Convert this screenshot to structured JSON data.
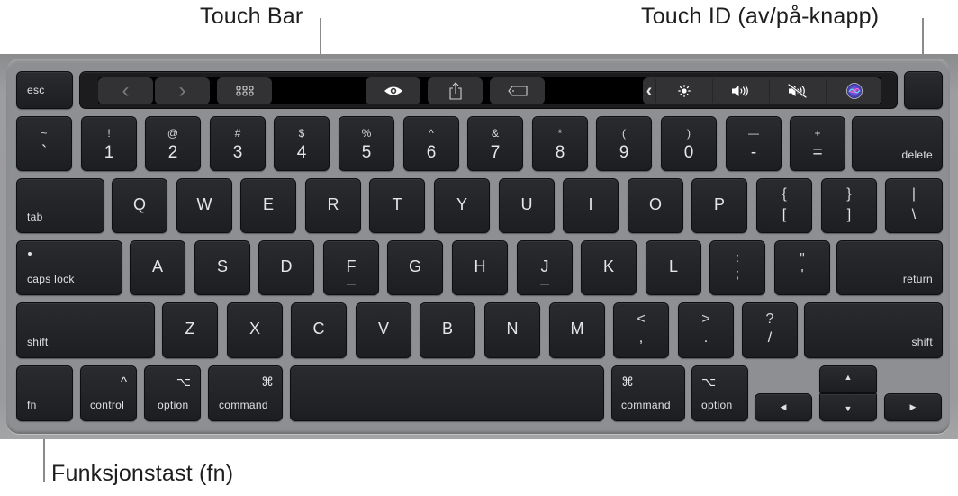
{
  "callouts": {
    "touch_bar": "Touch Bar",
    "touch_id": "Touch ID (av/på-knapp)",
    "fn_key": "Funksjonstast (fn)"
  },
  "touch_bar": {
    "back_icon": "‹",
    "forward_icon": "›",
    "grid_icon": "grid-view",
    "eye_icon": "quick-look",
    "share_icon": "share",
    "tag_icon": "tag",
    "collapse_icon": "‹",
    "brightness_icon": "brightness",
    "volume_icon": "volume",
    "mute_icon": "mute",
    "siri_icon": "siri"
  },
  "keys": {
    "esc": "esc",
    "row1": [
      {
        "top": "~",
        "bot": "`"
      },
      {
        "top": "!",
        "bot": "1"
      },
      {
        "top": "@",
        "bot": "2"
      },
      {
        "top": "#",
        "bot": "3"
      },
      {
        "top": "$",
        "bot": "4"
      },
      {
        "top": "%",
        "bot": "5"
      },
      {
        "top": "^",
        "bot": "6"
      },
      {
        "top": "&",
        "bot": "7"
      },
      {
        "top": "*",
        "bot": "8"
      },
      {
        "top": "(",
        "bot": "9"
      },
      {
        "top": ")",
        "bot": "0"
      },
      {
        "top": "—",
        "bot": "-"
      },
      {
        "top": "+",
        "bot": "="
      }
    ],
    "delete": "delete",
    "tab": "tab",
    "row2": [
      "Q",
      "W",
      "E",
      "R",
      "T",
      "Y",
      "U",
      "I",
      "O",
      "P"
    ],
    "row2_sym": [
      {
        "top": "{",
        "bot": "["
      },
      {
        "top": "}",
        "bot": "]"
      },
      {
        "top": "|",
        "bot": "\\"
      }
    ],
    "caps_lock": "caps lock",
    "row3": [
      "A",
      "S",
      "D",
      "F",
      "G",
      "H",
      "J",
      "K",
      "L"
    ],
    "row3_sym": [
      {
        "top": ":",
        "bot": ";"
      },
      {
        "top": "\"",
        "bot": "'"
      }
    ],
    "return": "return",
    "shift_left": "shift",
    "row4": [
      "Z",
      "X",
      "C",
      "V",
      "B",
      "N",
      "M"
    ],
    "row4_sym": [
      {
        "top": "<",
        "bot": ","
      },
      {
        "top": ">",
        "bot": "."
      },
      {
        "top": "?",
        "bot": "/"
      }
    ],
    "shift_right": "shift",
    "fn": "fn",
    "control": {
      "label": "control",
      "symbol": "^"
    },
    "option_left": {
      "label": "option",
      "symbol": "⌥"
    },
    "command_left": {
      "label": "command",
      "symbol": "⌘"
    },
    "command_right": {
      "label": "command",
      "symbol": "⌘"
    },
    "option_right": {
      "label": "option",
      "symbol": "⌥"
    },
    "arrows": {
      "left": "◀",
      "up": "▲",
      "down": "▼",
      "right": "▶"
    }
  }
}
